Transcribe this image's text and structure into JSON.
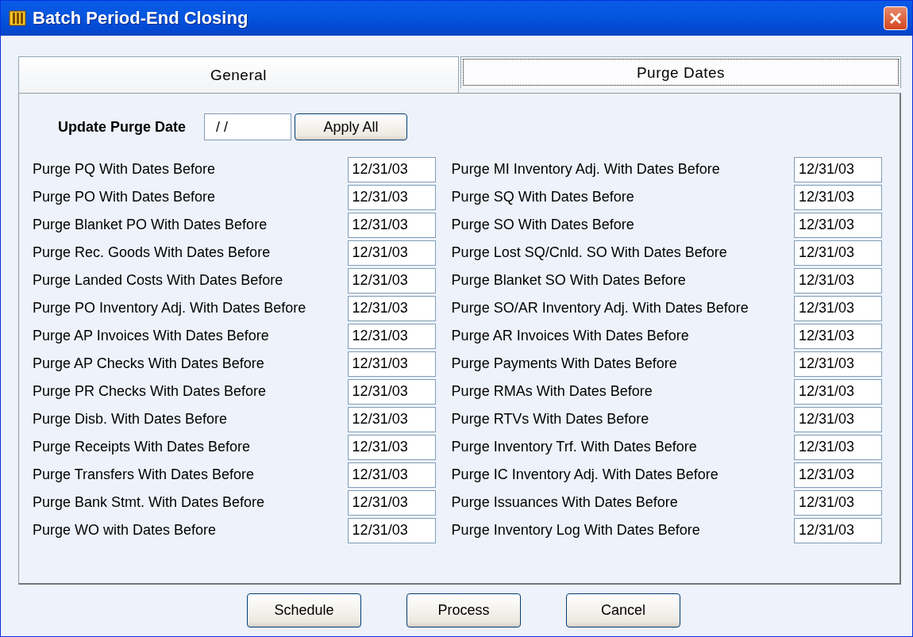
{
  "window": {
    "title": "Batch Period-End Closing"
  },
  "tabs": [
    {
      "label": "General",
      "selected": false
    },
    {
      "label": "Purge Dates",
      "selected": true
    }
  ],
  "update_purge_date": {
    "label": "Update Purge Date",
    "value": "/ /",
    "button": "Apply All"
  },
  "left_rows": [
    {
      "label": "Purge PQ With Dates Before",
      "value": "12/31/03"
    },
    {
      "label": "Purge PO With Dates Before",
      "value": "12/31/03"
    },
    {
      "label": "Purge Blanket PO With Dates Before",
      "value": "12/31/03"
    },
    {
      "label": "Purge Rec. Goods With Dates Before",
      "value": "12/31/03"
    },
    {
      "label": "Purge Landed Costs With Dates Before",
      "value": "12/31/03"
    },
    {
      "label": "Purge PO Inventory Adj. With Dates Before",
      "value": "12/31/03"
    },
    {
      "label": "Purge AP Invoices With Dates Before",
      "value": "12/31/03"
    },
    {
      "label": "Purge AP Checks With Dates Before",
      "value": "12/31/03"
    },
    {
      "label": "Purge PR Checks With Dates Before",
      "value": "12/31/03"
    },
    {
      "label": "Purge Disb. With Dates Before",
      "value": "12/31/03"
    },
    {
      "label": "Purge Receipts With Dates Before",
      "value": "12/31/03"
    },
    {
      "label": "Purge Transfers With Dates Before",
      "value": "12/31/03"
    },
    {
      "label": "Purge Bank Stmt. With Dates Before",
      "value": "12/31/03"
    },
    {
      "label": "Purge WO with Dates Before",
      "value": "12/31/03"
    }
  ],
  "right_rows": [
    {
      "label": "Purge MI Inventory Adj. With Dates Before",
      "value": "12/31/03"
    },
    {
      "label": "Purge SQ With Dates Before",
      "value": "12/31/03"
    },
    {
      "label": "Purge SO With Dates Before",
      "value": "12/31/03"
    },
    {
      "label": "Purge Lost SQ/Cnld. SO With Dates Before",
      "value": "12/31/03"
    },
    {
      "label": "Purge Blanket SO With Dates Before",
      "value": "12/31/03"
    },
    {
      "label": "Purge SO/AR Inventory Adj. With Dates Before",
      "value": "12/31/03"
    },
    {
      "label": "Purge AR Invoices With Dates Before",
      "value": "12/31/03"
    },
    {
      "label": "Purge Payments With Dates Before",
      "value": "12/31/03"
    },
    {
      "label": "Purge RMAs With Dates Before",
      "value": "12/31/03"
    },
    {
      "label": "Purge RTVs With Dates Before",
      "value": "12/31/03"
    },
    {
      "label": "Purge Inventory Trf. With Dates Before",
      "value": "12/31/03"
    },
    {
      "label": "Purge IC Inventory Adj. With Dates Before",
      "value": "12/31/03"
    },
    {
      "label": "Purge Issuances With Dates Before",
      "value": "12/31/03"
    },
    {
      "label": "Purge Inventory Log With Dates Before",
      "value": "12/31/03"
    }
  ],
  "buttons": [
    "Schedule",
    "Process",
    "Cancel"
  ]
}
